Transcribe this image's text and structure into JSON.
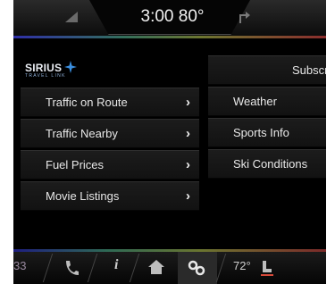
{
  "status": {
    "time_temp": "3:00  80°"
  },
  "logo": {
    "brand": "SIRIUS",
    "sub": "TRAVEL LINK"
  },
  "menu_left": [
    {
      "label": "Traffic on Route",
      "chevron": "›"
    },
    {
      "label": "Traffic Nearby",
      "chevron": "›"
    },
    {
      "label": "Fuel Prices",
      "chevron": "›"
    },
    {
      "label": "Movie Listings",
      "chevron": "›"
    }
  ],
  "menu_right": {
    "header": "Subscription In",
    "items": [
      {
        "label": "Weather"
      },
      {
        "label": "Sports Info"
      },
      {
        "label": "Ski Conditions"
      }
    ]
  },
  "bottombar": {
    "left_value": "33",
    "info_label": "i",
    "temp": "72°"
  },
  "colors": {
    "screen_bg": "#000000",
    "row_text": "#e8e8e8",
    "accent_blue": "#2f2fa8",
    "accent_red": "#8b2d2d"
  }
}
